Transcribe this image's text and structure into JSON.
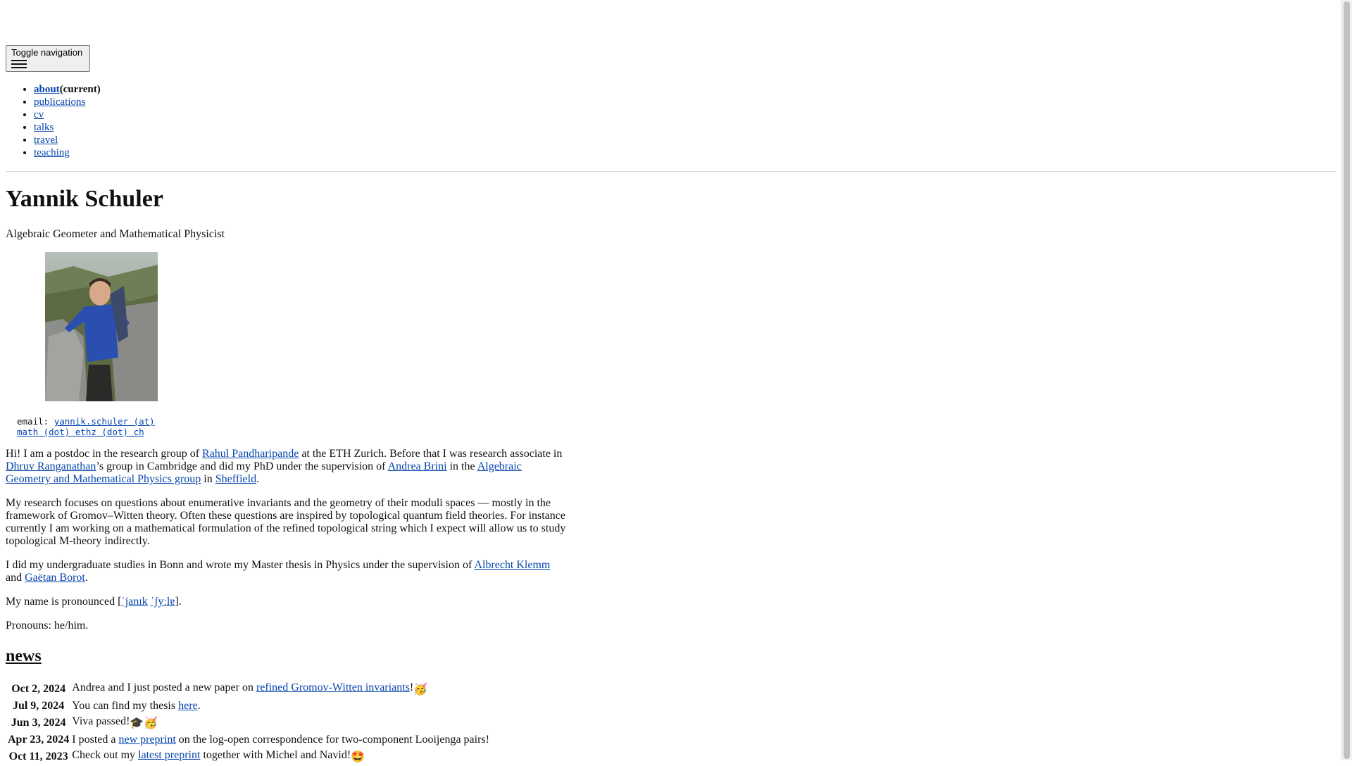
{
  "header": {
    "toggle_label": "Toggle navigation"
  },
  "nav": {
    "items": [
      {
        "label": "about",
        "suffix": "(current)"
      },
      {
        "label": "publications"
      },
      {
        "label": "cv"
      },
      {
        "label": "talks"
      },
      {
        "label": "travel"
      },
      {
        "label": "teaching"
      }
    ]
  },
  "profile": {
    "name": "Yannik Schuler",
    "subtitle": "Algebraic Geometer and Mathematical Physicist",
    "email_label": "email:",
    "email_line1": "yannik.schuler (at)",
    "email_line2": "math (dot) ethz (dot) ch"
  },
  "about": {
    "p1": {
      "a": "Hi! I am a postdoc in the research group of ",
      "link1": "Rahul Pandharipande",
      "b": " at the ETH Zurich. Before that I was research associate in ",
      "link2": "Dhruv Ranganathan",
      "c": "’s group in Cambridge and did my PhD under the supervision of ",
      "link3": "Andrea Brini",
      "d": " in the ",
      "link4": "Algebraic Geometry and Mathematical Physics group",
      "e": " in ",
      "link5": "Sheffield",
      "f": "."
    },
    "p2": "My research focuses on questions about enumerative invariants and the geometry of their moduli spaces — mostly in the framework of Gromov–Witten theory. Often these questions are inspired by topological quantum field theories. For instance currently I am working on a mathematical formulation of the refined topological string which I expect will allow us to study topological M-theory indirectly.",
    "p3": {
      "a": "I did my undergraduate studies in Bonn and wrote my Master thesis in Physics under the supervision of ",
      "link1": "Albrecht Klemm",
      "b": " and ",
      "link2": "Gaëtan Borot",
      "c": "."
    },
    "p4": {
      "a": "My name is pronounced [",
      "link1": "ˈjanɪk",
      "b": " ",
      "link2": "ˈʃyːlɐ",
      "c": "]."
    },
    "p5": "Pronouns: he/him."
  },
  "news": {
    "heading": "news",
    "items": [
      {
        "date": "Oct 2, 2024",
        "a": "Andrea and I just posted a new paper on ",
        "link": "refined Gromov-Witten invariants",
        "b": "!",
        "emoji": "🥳"
      },
      {
        "date": "Jul 9, 2024",
        "a": "You can find my thesis ",
        "link": "here",
        "b": ".",
        "emoji": ""
      },
      {
        "date": "Jun 3, 2024",
        "a": "Viva passed!",
        "link": "",
        "b": "",
        "emoji": "🎓🥳"
      },
      {
        "date": "Apr 23, 2024",
        "a": "I posted a ",
        "link": "new preprint",
        "b": " on the log-open correspondence for two-component Looijenga pairs!",
        "emoji": ""
      },
      {
        "date": "Oct 11, 2023",
        "a": "Check out my ",
        "link": "latest preprint",
        "b": " together with Michel and Navid!",
        "emoji": "🤩"
      }
    ]
  },
  "colors": {
    "link": "#0645ad",
    "text": "#111111",
    "divider": "#d9d9d9"
  }
}
